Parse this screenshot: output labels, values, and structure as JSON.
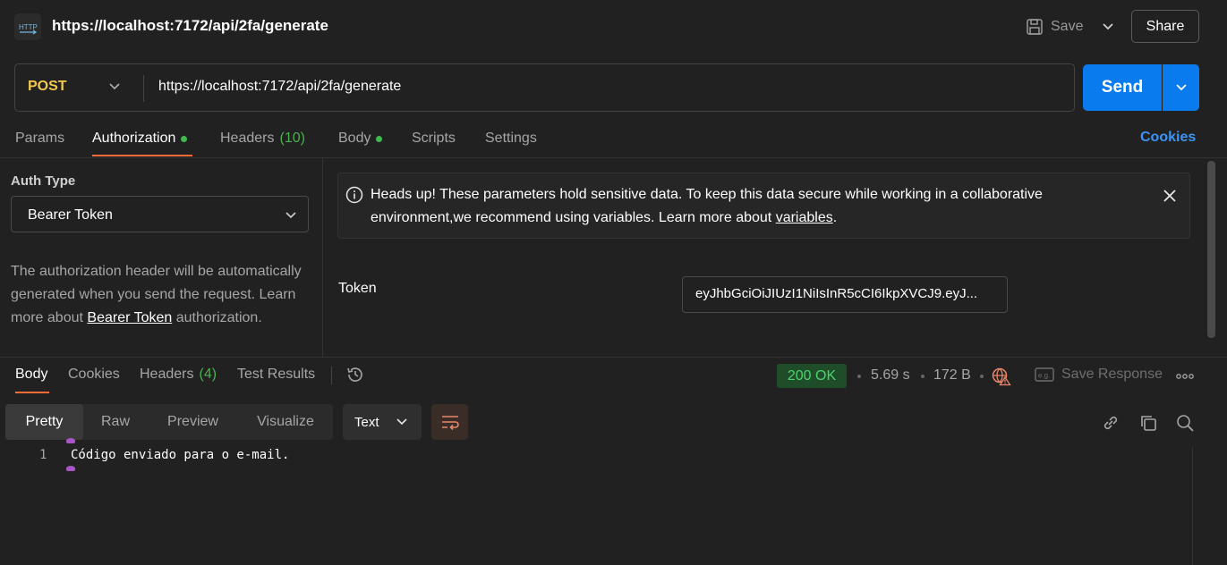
{
  "titlebar": {
    "title": "https://localhost:7172/api/2fa/generate",
    "icon": "http-icon",
    "save_label": "Save",
    "share_label": "Share"
  },
  "request": {
    "method": "POST",
    "url": "https://localhost:7172/api/2fa/generate",
    "send_label": "Send"
  },
  "tabs": {
    "params": "Params",
    "authorization": "Authorization",
    "headers": "Headers",
    "headers_count": "(10)",
    "body": "Body",
    "scripts": "Scripts",
    "settings": "Settings",
    "cookies": "Cookies"
  },
  "auth": {
    "type_label": "Auth Type",
    "type_value": "Bearer Token",
    "desc_prefix": "The authorization header will be automatically generated when you send the request. Learn more about ",
    "desc_link": "Bearer Token",
    "desc_suffix": " authorization."
  },
  "notice": {
    "text_prefix": "Heads up! These parameters hold sensitive data. To keep this data secure while working in a collaborative environment,we recommend using variables. Learn more about ",
    "link": "variables",
    "text_suffix": "."
  },
  "token": {
    "label": "Token",
    "value": "eyJhbGciOiJIUzI1NiIsInR5cCI6IkpXVCJ9.eyJ..."
  },
  "response": {
    "tabs": {
      "body": "Body",
      "cookies": "Cookies",
      "headers": "Headers",
      "headers_count": "(4)",
      "test_results": "Test Results"
    },
    "status": "200 OK",
    "time": "5.69 s",
    "size": "172 B",
    "save_response": "Save Response",
    "views": [
      "Pretty",
      "Raw",
      "Preview",
      "Visualize"
    ],
    "format": "Text",
    "line_number": "1",
    "body_text": "Código enviado para o e-mail."
  },
  "colors": {
    "accent": "#ff6c37",
    "send": "#097bed",
    "method": "#f2c94c",
    "success": "#4ed36b"
  }
}
